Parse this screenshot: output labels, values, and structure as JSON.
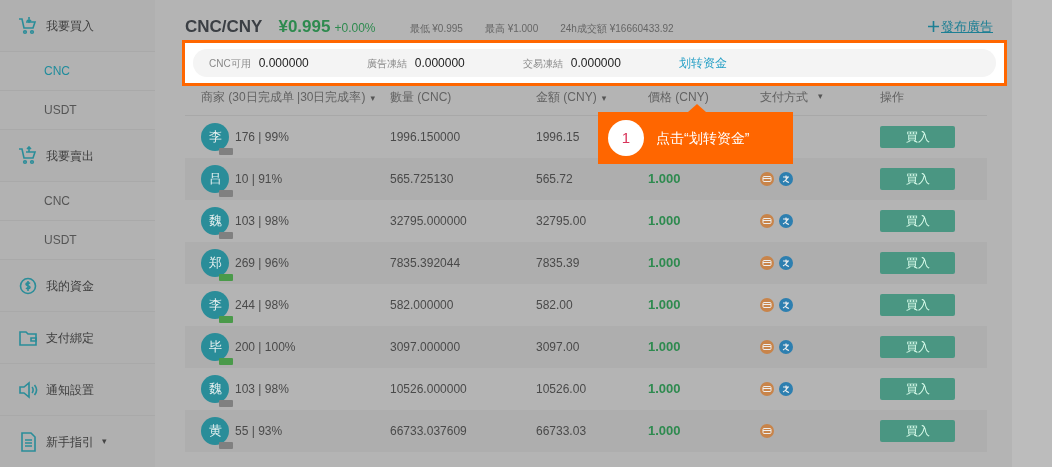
{
  "sidebar": {
    "sections": [
      {
        "kind": "buy",
        "label": "我要買入",
        "items": [
          {
            "label": "CNC",
            "selected": true
          },
          {
            "label": "USDT",
            "selected": false
          }
        ]
      },
      {
        "kind": "sell",
        "label": "我要賣出",
        "items": [
          {
            "label": "CNC",
            "selected": false
          },
          {
            "label": "USDT",
            "selected": false
          }
        ]
      },
      {
        "kind": "funds",
        "label": "我的資金"
      },
      {
        "kind": "payment",
        "label": "支付綁定"
      },
      {
        "kind": "notify",
        "label": "通知設置"
      },
      {
        "kind": "guide",
        "label": "新手指引",
        "caret": "▾"
      }
    ]
  },
  "header": {
    "pair": "CNC/CNY",
    "price": "¥0.995",
    "change": "+0.00%",
    "stats": [
      "最低 ¥0.995",
      "最高 ¥1.000",
      "24h成交額 ¥16660433.92"
    ],
    "post_ad": "發布廣告"
  },
  "balances": {
    "items": [
      {
        "label": "CNC可用",
        "value": "0.000000"
      },
      {
        "label": "廣告凍結",
        "value": "0.000000"
      },
      {
        "label": "交易凍結",
        "value": "0.000000"
      }
    ],
    "transfer_link": "划转资金"
  },
  "table": {
    "columns": [
      {
        "label": "商家 (30日完成单 |30日完成率)",
        "sort_icon": "▾"
      },
      {
        "label": "數量 (CNC)"
      },
      {
        "label": "金額 (CNY)",
        "sort_icon": "▾"
      },
      {
        "label": "價格 (CNY)"
      },
      {
        "label": "支付方式",
        "sort_icon": "▾"
      },
      {
        "label": "操作"
      }
    ],
    "rows": [
      {
        "avatar": "李",
        "tag": {
          "color": "#808080"
        },
        "stats": "176 | 99%",
        "quantity": "1996.150000",
        "amount": "1996.15",
        "action": "買入"
      },
      {
        "avatar": "吕",
        "tag": {
          "color": "#808080"
        },
        "stats": "10 | 91%",
        "quantity": "565.725130",
        "amount": "565.72",
        "price": "1.000",
        "payments": [
          {
            "kind": "card"
          },
          {
            "kind": "alipay"
          }
        ],
        "action": "買入"
      },
      {
        "avatar": "魏",
        "tag": {
          "color": "#808080"
        },
        "stats": "103 | 98%",
        "quantity": "32795.000000",
        "amount": "32795.00",
        "price": "1.000",
        "payments": [
          {
            "kind": "card"
          },
          {
            "kind": "alipay"
          }
        ],
        "action": "買入"
      },
      {
        "avatar": "郑",
        "tag": {
          "color": "#4a9a4a"
        },
        "stats": "269 | 96%",
        "quantity": "7835.392044",
        "amount": "7835.39",
        "price": "1.000",
        "payments": [
          {
            "kind": "card"
          },
          {
            "kind": "alipay"
          }
        ],
        "action": "買入"
      },
      {
        "avatar": "李",
        "tag": {
          "color": "#4a9a4a"
        },
        "stats": "244 | 98%",
        "quantity": "582.000000",
        "amount": "582.00",
        "price": "1.000",
        "payments": [
          {
            "kind": "card"
          },
          {
            "kind": "alipay"
          }
        ],
        "action": "買入"
      },
      {
        "avatar": "毕",
        "tag": {
          "color": "#4a9a4a"
        },
        "stats": "200 | 100%",
        "quantity": "3097.000000",
        "amount": "3097.00",
        "price": "1.000",
        "payments": [
          {
            "kind": "card"
          },
          {
            "kind": "alipay"
          }
        ],
        "action": "買入"
      },
      {
        "avatar": "魏",
        "tag": {
          "color": "#808080"
        },
        "stats": "103 | 98%",
        "quantity": "10526.000000",
        "amount": "10526.00",
        "price": "1.000",
        "payments": [
          {
            "kind": "card"
          },
          {
            "kind": "alipay"
          }
        ],
        "action": "買入"
      },
      {
        "avatar": "黄",
        "tag": {
          "color": "#808080"
        },
        "stats": "55 | 93%",
        "quantity": "66733.037609",
        "amount": "66733.03",
        "price": "1.000",
        "payments": [
          {
            "kind": "card"
          }
        ],
        "action": "買入"
      }
    ]
  },
  "callout": {
    "number": "1",
    "text": "点击“划转资金”"
  }
}
